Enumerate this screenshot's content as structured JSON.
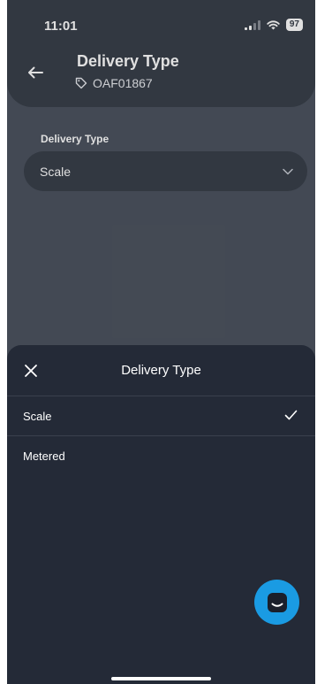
{
  "status_bar": {
    "time": "11:01",
    "battery": "97"
  },
  "header": {
    "title": "Delivery Type",
    "order_id": "OAF01867"
  },
  "form": {
    "label": "Delivery Type",
    "selected_value": "Scale"
  },
  "sheet": {
    "title": "Delivery Type",
    "options": [
      {
        "label": "Scale",
        "selected": true
      },
      {
        "label": "Metered",
        "selected": false
      }
    ]
  },
  "colors": {
    "screen_bg": "#4d5460",
    "header_bg": "#3a404b",
    "sheet_bg": "#242a37",
    "fab_bg": "#1a9be3"
  },
  "icons": {
    "back": "arrow-left-icon",
    "tag": "tag-icon",
    "dropdown": "chevron-down-icon",
    "close": "close-icon",
    "check": "checkmark-icon",
    "chat": "chat-icon"
  }
}
